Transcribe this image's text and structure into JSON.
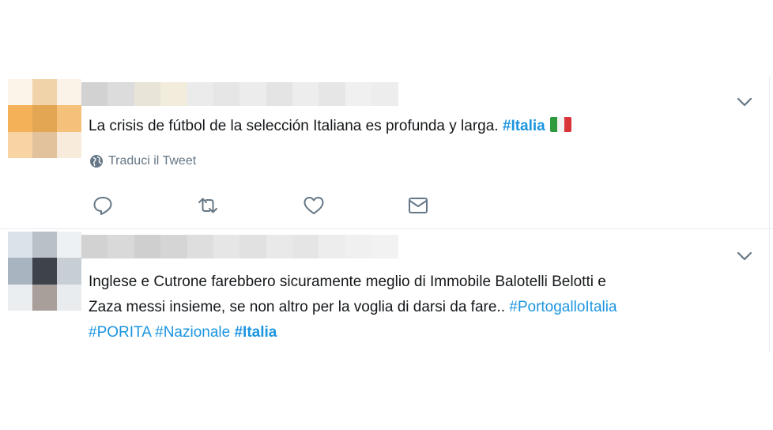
{
  "tweets": [
    {
      "text": "La crisis de fútbol de la selección Italiana es profunda y larga. ",
      "hashtags": [
        "#Italia"
      ],
      "translate_label": "Traduci il Tweet",
      "icons": {
        "more": "chevron-down-icon",
        "translate": "globe-icon",
        "reply": "reply-icon",
        "retweet": "retweet-icon",
        "like": "heart-icon",
        "dm": "envelope-icon"
      }
    },
    {
      "text_line1": "Inglese e Cutrone farebbero sicuramente meglio di Immobile Balotelli Belotti e",
      "text_line2": "Zaza messi insieme, se non altro per la voglia di darsi da fare.. ",
      "hashtags": [
        "#PortogalloItalia",
        "#PORITA",
        "#Nazionale",
        "#Italia"
      ],
      "icons": {
        "more": "chevron-down-icon"
      }
    }
  ],
  "colors": {
    "text": "#14171a",
    "hashtag": "#1b95e0",
    "muted": "#657786",
    "divider": "#e6ecf0"
  }
}
